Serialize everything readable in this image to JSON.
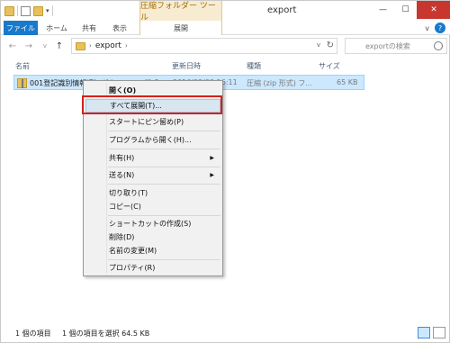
{
  "title_bar": {
    "tool_tab": "圧縮フォルダー ツール",
    "window_title": "export",
    "controls": {
      "minimize": "—",
      "maximize": "☐",
      "close": "✕"
    }
  },
  "ribbon": {
    "tabs": [
      "ファイル",
      "ホーム",
      "共有",
      "表示",
      "展開"
    ],
    "expand_icon": "v",
    "help_icon": "?"
  },
  "nav": {
    "back_icon": "←",
    "forward_icon": "→",
    "recent_icon": "v",
    "up_icon": "↑",
    "breadcrumb": "export",
    "breadcrumb_arrow": "›",
    "refresh_icon": "↻",
    "address_dropdown": "v",
    "search_placeholder": "exportの検索"
  },
  "columns": [
    "名前",
    "更新日時",
    "種類",
    "サイズ"
  ],
  "file": {
    "name": "001登記識別情報通知ダウンロード様式.zip",
    "modified": "2016/02/09 16:11",
    "type": "圧縮 (zip 形式) フ...",
    "size": "65 KB"
  },
  "context_menu": {
    "items": [
      {
        "label": "開く(O)"
      },
      {
        "label": "すべて展開(T)..."
      },
      {
        "label": "スタートにピン留め(P)"
      },
      {
        "label": "プログラムから開く(H)..."
      },
      {
        "label": "共有(H)",
        "submenu": "▶"
      },
      {
        "label": "送る(N)",
        "submenu": "▶"
      },
      {
        "label": "切り取り(T)"
      },
      {
        "label": "コピー(C)"
      },
      {
        "label": "ショートカットの作成(S)"
      },
      {
        "label": "削除(D)"
      },
      {
        "label": "名前の変更(M)"
      },
      {
        "label": "プロパティ(R)"
      }
    ]
  },
  "status": {
    "count": "1 個の項目",
    "selection": "1 個の項目を選択  64.5 KB"
  },
  "colors": {
    "accent": "#1979ca",
    "selection": "#cce8ff",
    "highlight_border": "#d4201a",
    "tool_tab": "#f7ecd2"
  }
}
